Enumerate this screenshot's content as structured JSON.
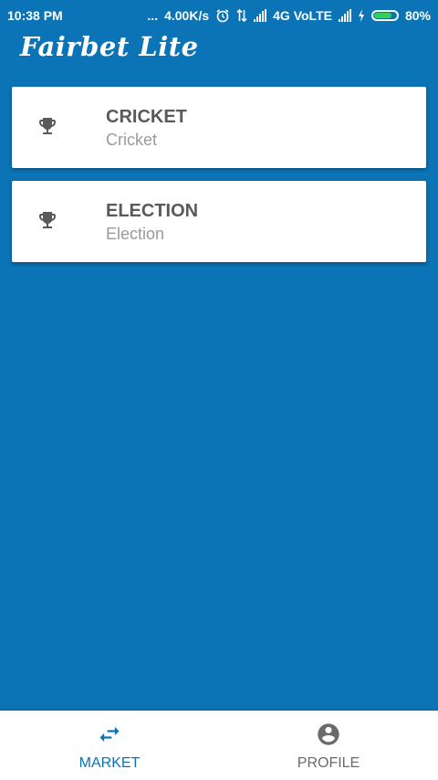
{
  "status_bar": {
    "time": "10:38 PM",
    "dots": "...",
    "speed": "4.00K/s",
    "network": "4G VoLTE",
    "battery": "80%"
  },
  "app": {
    "title": "Fairbet Lite"
  },
  "categories": [
    {
      "title": "CRICKET",
      "subtitle": "Cricket",
      "icon": "trophy-icon"
    },
    {
      "title": "ELECTION",
      "subtitle": "Election",
      "icon": "trophy-icon"
    }
  ],
  "bottom_nav": {
    "items": [
      {
        "label": "MARKET",
        "icon": "swap-arrows-icon",
        "active": true
      },
      {
        "label": "PROFILE",
        "icon": "account-circle-icon",
        "active": false
      }
    ]
  },
  "colors": {
    "background": "#0b74b6",
    "active_nav": "#0b74b6",
    "inactive_nav": "#6a6a6a"
  }
}
